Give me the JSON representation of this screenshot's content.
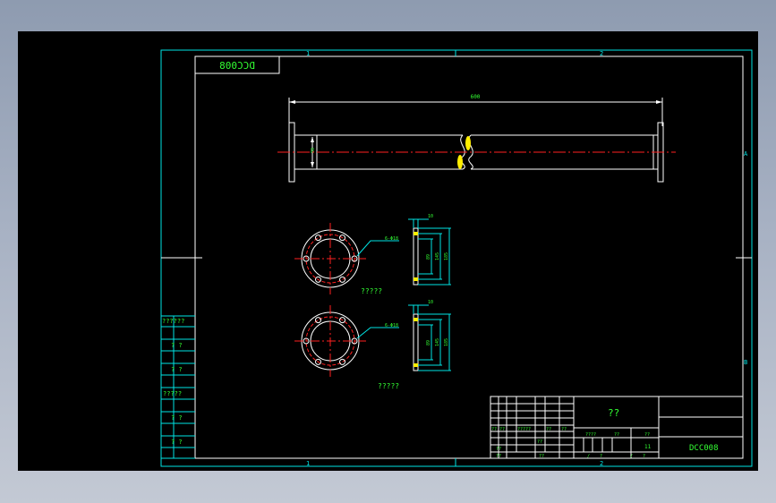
{
  "drawing": {
    "top_box_label": "DCC008",
    "zone_top_1": "1",
    "zone_top_2": "2",
    "zone_bottom_1": "1",
    "zone_bottom_2": "2",
    "zone_right_a": "A",
    "zone_right_b": "B"
  },
  "pipe": {
    "length_dim": "600",
    "diameter_dim": "89"
  },
  "flange_1": {
    "bolt_callout": "6-Φ18",
    "thickness_dim": "10",
    "dims": [
      "89",
      "145",
      "185"
    ],
    "label": "?????"
  },
  "flange_2": {
    "bolt_callout": "6-Φ18",
    "thickness_dim": "10",
    "dims": [
      "89",
      "145",
      "185"
    ],
    "label": "?????"
  },
  "left_panel": [
    "??????",
    "? ?",
    "? ?",
    "?????",
    "? ?",
    "? ?"
  ],
  "title_block": {
    "material": "??",
    "drawing_number": "DCC008",
    "row_a": [
      "??",
      "??",
      "?????",
      "??",
      "??"
    ],
    "row_b": [
      "??",
      "??",
      "????",
      "??",
      "??"
    ],
    "row_c": [
      "??",
      "??",
      "/",
      "?",
      "/",
      "?"
    ],
    "scale_text": "11"
  },
  "colors": {
    "border": "#00e5e5",
    "geometry": "#ffffff",
    "centerline": "#ff2020",
    "dimension": "#00e5e5",
    "text": "#33ff33",
    "highlight": "#ffee00"
  }
}
